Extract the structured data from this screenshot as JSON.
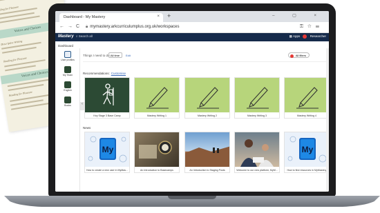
{
  "paper": {
    "headings": [
      "Reading for Pleasure",
      "Voices and Choices",
      "Descriptive Writing",
      "Voices and Choices",
      "Reading for Pleasure"
    ],
    "bands": [
      "Voices and Choices",
      "Voices and Choices"
    ]
  },
  "browser": {
    "tab_title": "Dashboard - My Mastery",
    "tab_close": "×",
    "new_tab": "+",
    "window_controls": "– ▢ ×",
    "url": "mymastery.arkcurriculumplus.org.uk/workspaces",
    "nav": {
      "back": "←",
      "forward": "→",
      "reload": "C"
    }
  },
  "app": {
    "brand": "Mastery",
    "search_placeholder": "Search all",
    "apps_label": "Apps",
    "user_label": "Researcher",
    "breadcrumb": "Dashboard"
  },
  "sidebar": {
    "items": [
      {
        "label": "User profiles",
        "icon": "user-icon"
      },
      {
        "label": "My Team",
        "icon": "team-icon"
      },
      {
        "label": "English",
        "icon": "book-icon"
      },
      {
        "label": "Books",
        "icon": "books-icon"
      }
    ]
  },
  "toolbar": {
    "prompt": "Things I need to do:",
    "select_value": "All time",
    "link": "Edit",
    "filter": "All filters"
  },
  "recommendations": {
    "title": "Recommendations",
    "link": "Customise",
    "cards": [
      {
        "caption": "Key Stage 3 Base Camp",
        "style": "dark",
        "icon": "hiker-icon"
      },
      {
        "caption": "Mastery Writing 1",
        "style": "green",
        "icon": "pen-icon"
      },
      {
        "caption": "Mastery Writing 2",
        "style": "green",
        "icon": "pen-icon"
      },
      {
        "caption": "Mastery Writing 3",
        "style": "green",
        "icon": "pen-icon"
      },
      {
        "caption": "Mastery Writing 4",
        "style": "green",
        "icon": "pen-icon"
      }
    ]
  },
  "news": {
    "title": "News",
    "cards": [
      {
        "caption": "How to create a new user in MyMas...",
        "style": "my",
        "badge": "My"
      },
      {
        "caption": "An Introduction to Basecamps",
        "style": "photo-compass"
      },
      {
        "caption": "An Introduction to Staging Posts",
        "style": "photo-sky"
      },
      {
        "caption": "Welcome to our new platform, MyM...",
        "style": "photo-people"
      },
      {
        "caption": "How to find resources in MyMastery",
        "style": "my",
        "badge": "My"
      }
    ]
  },
  "colors": {
    "appbar": "#152a4a",
    "green_card": "#b7d57b",
    "dark_card": "#2c4a34",
    "my_badge": "#1565c0",
    "accent_red": "#e53935"
  }
}
